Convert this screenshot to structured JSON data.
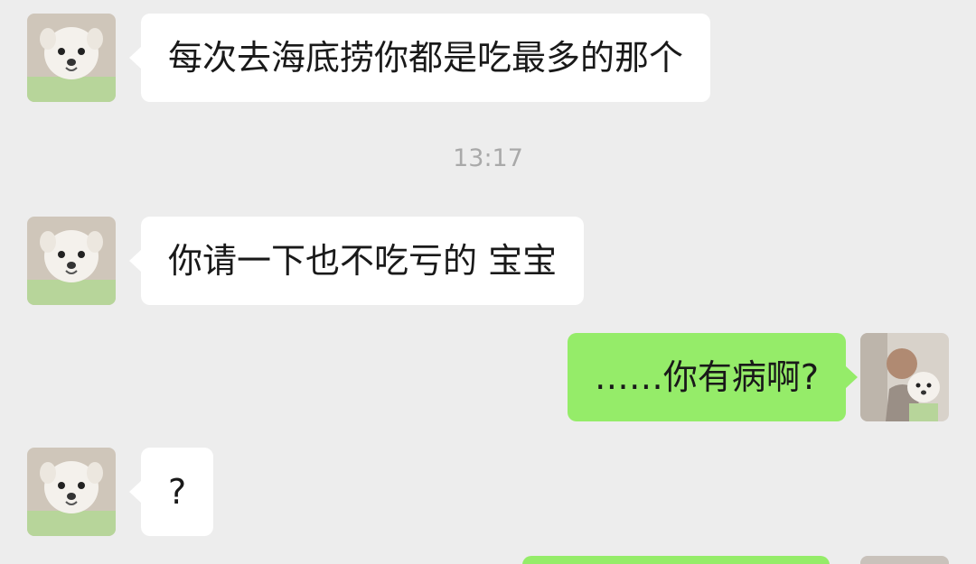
{
  "messages": [
    {
      "side": "left",
      "text": "每次去海底捞你都是吃最多的那个"
    },
    {
      "side": "left",
      "text": "你请一下也不吃亏的 宝宝"
    },
    {
      "side": "right",
      "text": "……你有病啊?"
    },
    {
      "side": "left",
      "text": "?"
    }
  ],
  "timestamp": "13:17",
  "avatars": {
    "friend": "white-dog-avatar",
    "self": "person-with-dog-avatar"
  },
  "colors": {
    "background": "#ededed",
    "incoming_bubble": "#ffffff",
    "outgoing_bubble": "#95ec69",
    "timestamp_text": "#a9a9a9"
  }
}
